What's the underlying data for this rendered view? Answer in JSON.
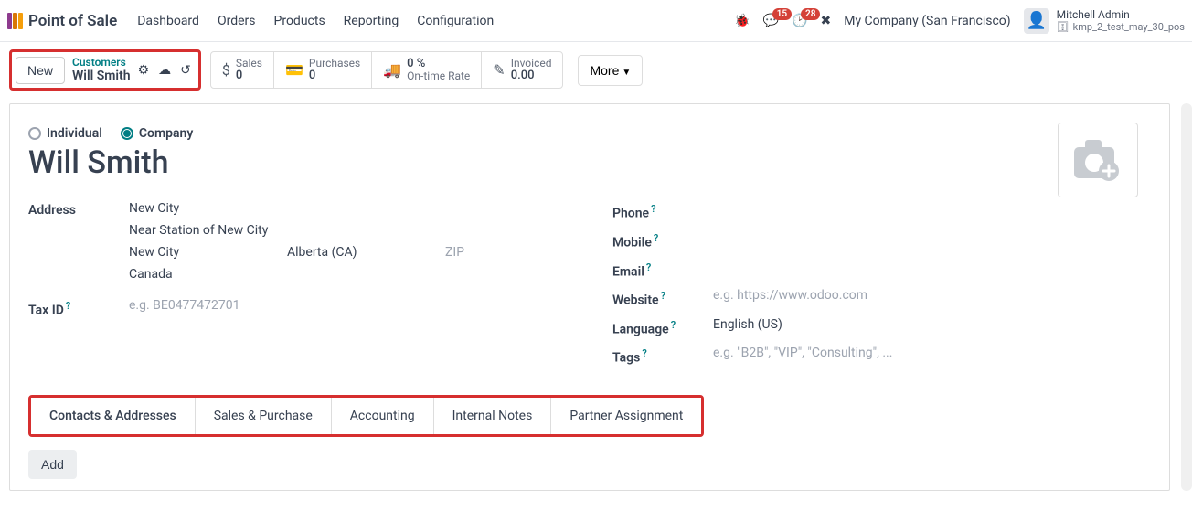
{
  "app": {
    "name": "Point of Sale"
  },
  "menu": [
    "Dashboard",
    "Orders",
    "Products",
    "Reporting",
    "Configuration"
  ],
  "top_right": {
    "chat_badge": "15",
    "activity_badge": "28",
    "company": "My Company (San Francisco)",
    "user_name": "Mitchell Admin",
    "db_name": "kmp_2_test_may_30_pos"
  },
  "breadcrumb": {
    "new_label": "New",
    "parent": "Customers",
    "current": "Will Smith"
  },
  "stats": {
    "sales": {
      "label": "Sales",
      "value": "0"
    },
    "purchases": {
      "label": "Purchases",
      "value": "0"
    },
    "ontime": {
      "label": "On-time Rate",
      "value": "0 %"
    },
    "invoiced": {
      "label": "Invoiced",
      "value": "0.00"
    },
    "more": "More"
  },
  "form": {
    "radio_individual": "Individual",
    "radio_company": "Company",
    "name": "Will Smith",
    "labels": {
      "address": "Address",
      "tax_id": "Tax ID",
      "phone": "Phone",
      "mobile": "Mobile",
      "email": "Email",
      "website": "Website",
      "language": "Language",
      "tags": "Tags"
    },
    "address": {
      "street": "New City",
      "street2": "Near Station of New City",
      "city": "New City",
      "state": "Alberta (CA)",
      "zip": "ZIP",
      "country": "Canada"
    },
    "tax_id_placeholder": "e.g. BE0477472701",
    "website_placeholder": "e.g. https://www.odoo.com",
    "language_value": "English (US)",
    "tags_placeholder": "e.g. \"B2B\", \"VIP\", \"Consulting\", ..."
  },
  "tabs": [
    "Contacts & Addresses",
    "Sales & Purchase",
    "Accounting",
    "Internal Notes",
    "Partner Assignment"
  ],
  "add_label": "Add"
}
